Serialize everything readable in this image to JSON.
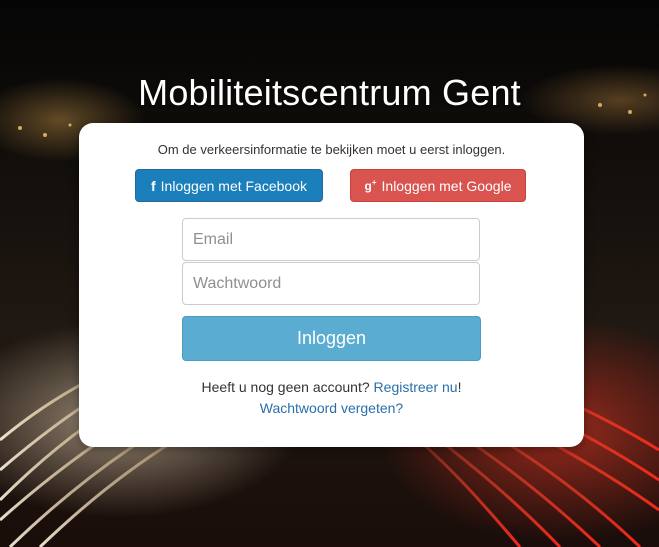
{
  "header": {
    "title": "Mobiliteitscentrum Gent"
  },
  "login": {
    "intro": "Om de verkeersinformatie te bekijken moet u eerst inloggen.",
    "facebook_label": "Inloggen met Facebook",
    "facebook_icon": "facebook-icon",
    "google_label": "Inloggen met Google",
    "google_icon": "google-plus-icon",
    "email_placeholder": "Email",
    "password_placeholder": "Wachtwoord",
    "submit_label": "Inloggen",
    "no_account_text": "Heeft u nog geen account?",
    "register_link": "Registreer nu",
    "register_suffix": "!",
    "forgot_link": "Wachtwoord vergeten?"
  },
  "colors": {
    "facebook": "#1a7fbb",
    "google": "#d9534f",
    "submit": "#5bacd1",
    "link": "#2a6fa8"
  }
}
